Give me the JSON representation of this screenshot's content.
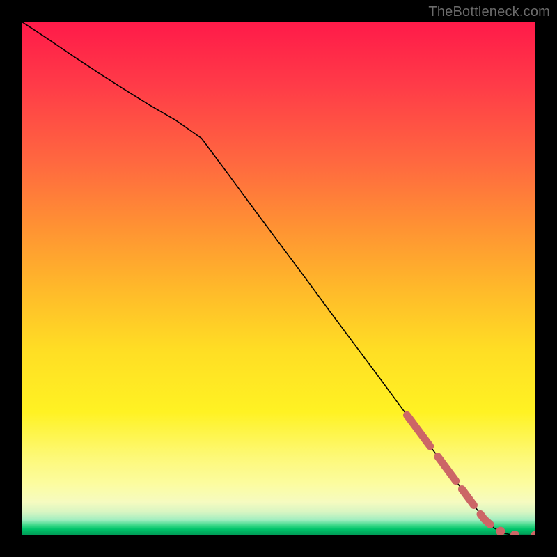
{
  "watermark": "TheBottleneck.com",
  "colors": {
    "marker": "#cc6666",
    "line": "#000000",
    "frame": "#000000"
  },
  "chart_data": {
    "type": "line",
    "title": "",
    "xlabel": "",
    "ylabel": "",
    "xlim": [
      0,
      100
    ],
    "ylim": [
      0,
      100
    ],
    "grid": false,
    "legend": false,
    "series": [
      {
        "name": "curve",
        "x": [
          0,
          5,
          10,
          15,
          20,
          25,
          30,
          35,
          40,
          45,
          50,
          55,
          60,
          65,
          70,
          75,
          80,
          82,
          84,
          86,
          88,
          90,
          92,
          94,
          95.5,
          97,
          100
        ],
        "y": [
          100,
          96.7,
          93.3,
          90.0,
          86.8,
          83.7,
          80.8,
          77.3,
          70.6,
          63.8,
          57.1,
          50.4,
          43.6,
          36.9,
          30.2,
          23.4,
          16.7,
          14.0,
          11.3,
          8.6,
          5.9,
          3.2,
          1.4,
          0.4,
          0.1,
          0.05,
          0.05
        ]
      }
    ],
    "markers": {
      "description": "salmon dashed segments and end dots overlaid on the curve near the bottom-right",
      "dash_segments_x": [
        [
          75,
          79.5
        ],
        [
          81,
          84.5
        ],
        [
          85.7,
          88
        ],
        [
          89.3,
          91.2
        ]
      ],
      "dots_x": [
        93.2,
        96.0,
        100.0
      ]
    }
  }
}
